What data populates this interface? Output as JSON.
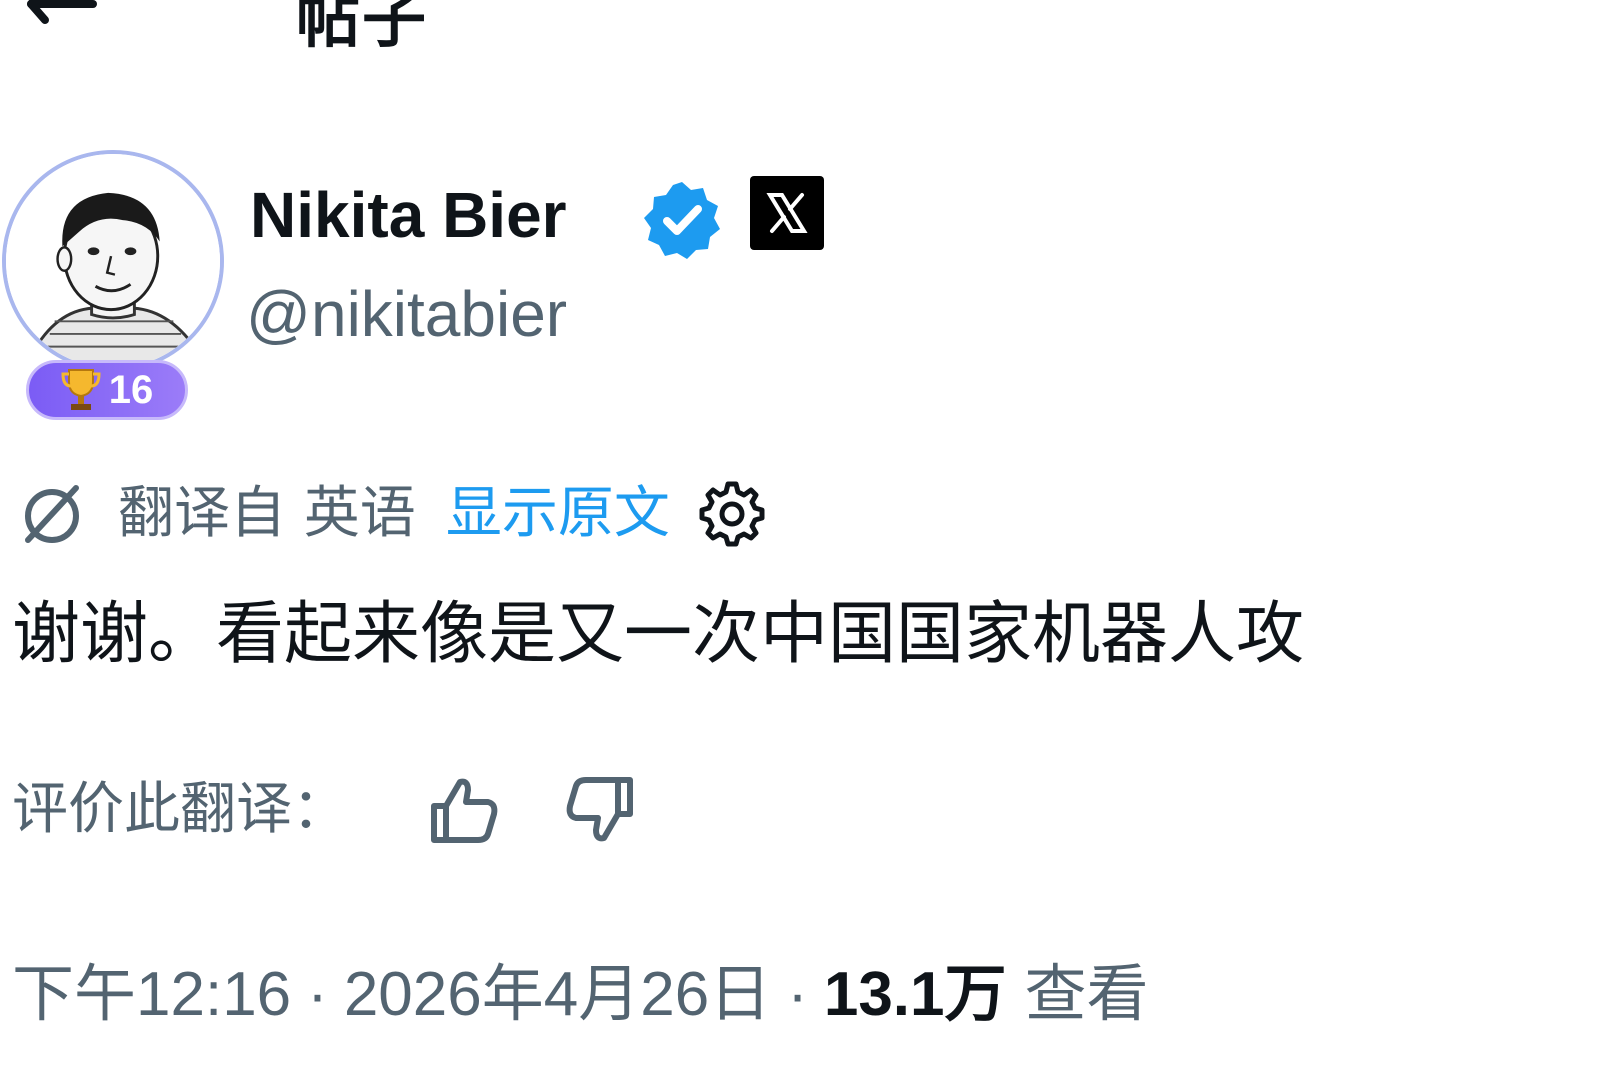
{
  "header": {
    "title": "帖子",
    "back_icon": "arrow-left-icon"
  },
  "author": {
    "name": "Nikita Bier",
    "handle": "@nikitabier",
    "verified": true,
    "verified_color": "#1d9bf0",
    "affiliate_icon": "x-logo-icon",
    "badge": {
      "icon": "trophy-icon",
      "count": "16"
    }
  },
  "translation": {
    "icon": "translate-icon",
    "translated_from": "翻译自 英语",
    "show_original": "显示原文",
    "settings_icon": "gear-icon"
  },
  "tweet": {
    "text": "谢谢。看起来像是又一次中国国家机器人攻"
  },
  "rating": {
    "label": "评价此翻译：",
    "up_icon": "thumbs-up-icon",
    "down_icon": "thumbs-down-icon"
  },
  "meta": {
    "time": "下午12:16",
    "separator": "·",
    "date": "2026年4月26日",
    "views_count": "13.1万",
    "views_label": "查看"
  },
  "colors": {
    "text_primary": "#0f1419",
    "text_secondary": "#536471",
    "link": "#1d9bf0",
    "badge": "#7b5cf5"
  }
}
